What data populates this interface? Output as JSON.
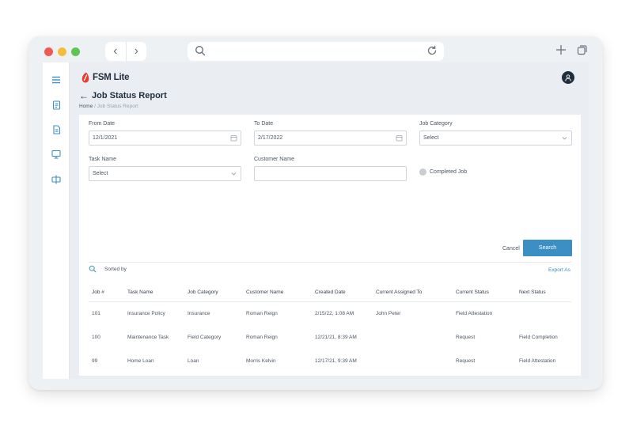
{
  "browser": {
    "nav_back_icon": "chevron-left-icon",
    "nav_forward_icon": "chevron-right-icon",
    "url": "",
    "icons": [
      "search-icon",
      "reload-icon",
      "plus-icon",
      "tabs-icon"
    ]
  },
  "app": {
    "logo_text": "FSM Lite",
    "brand_color": "#e63b2e",
    "accent_color": "#3b8fc4"
  },
  "sidebar": {
    "items": [
      "menu-icon",
      "reports-icon",
      "document-icon",
      "monitor-icon",
      "split-icon"
    ]
  },
  "page": {
    "back_icon": "←",
    "title": "Job Status Report",
    "breadcrumb_home": "Home",
    "breadcrumb_separator": " / ",
    "breadcrumb_current": "Job Status Report"
  },
  "filters": {
    "from_date_label": "From Date",
    "from_date_value": "12/1/2021",
    "to_date_label": "To Date",
    "to_date_value": "2/17/2022",
    "job_category_label": "Job Category",
    "job_category_value": "Select",
    "task_name_label": "Task Name",
    "task_name_value": "Select",
    "customer_name_label": "Customer Name",
    "customer_name_value": "",
    "completed_job_label": "Completed Job"
  },
  "actions": {
    "cancel_label": "Cancel",
    "search_label": "Search",
    "sorted_by_label": "Sorted by",
    "export_label": "Export As"
  },
  "table": {
    "headers": [
      "Job #",
      "Task Name",
      "Job Category",
      "Customer Name",
      "Created Date",
      "Current Assigned To",
      "Current Status",
      "Next Status"
    ],
    "rows": [
      [
        "101",
        "Insurance Policy",
        "Insurance",
        "Roman Reign",
        "2/15/22, 1:08 AM",
        "John Peter",
        "Field Attestation",
        ""
      ],
      [
        "100",
        "Maintenance Task",
        "Field Category",
        "Roman Reign",
        "12/21/21, 8:39 AM",
        "",
        "Request",
        "Field Completion"
      ],
      [
        "99",
        "Home Loan",
        "Loan",
        "Morris Kelvin",
        "12/17/21, 9:39 AM",
        "",
        "Request",
        "Field Attestation"
      ]
    ]
  }
}
